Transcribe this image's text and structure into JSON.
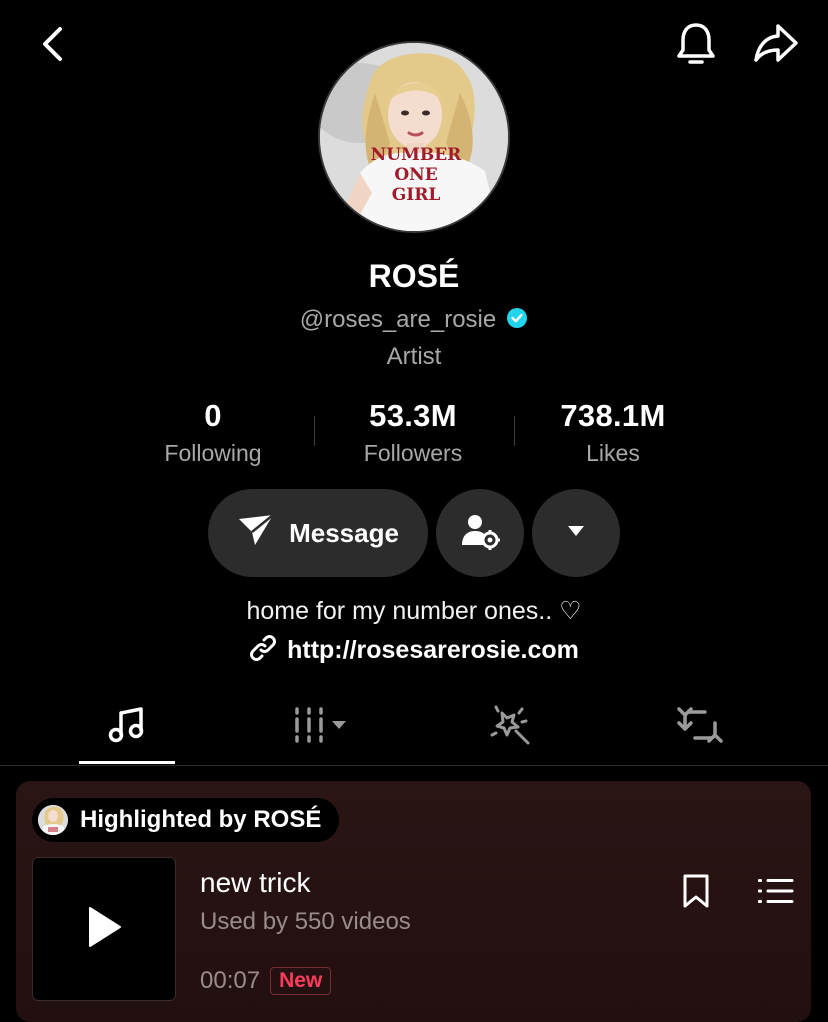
{
  "profile": {
    "name": "ROSÉ",
    "handle": "@roses_are_rosie",
    "category": "Artist",
    "shirt_text": [
      "NUMBER",
      "ONE",
      "GIRL"
    ]
  },
  "stats": [
    {
      "value": "0",
      "label": "Following"
    },
    {
      "value": "53.3M",
      "label": "Followers"
    },
    {
      "value": "738.1M",
      "label": "Likes"
    }
  ],
  "actions": {
    "message_label": "Message"
  },
  "bio": {
    "text": "home for my number ones.. ♡",
    "link": "http://rosesarerosie.com"
  },
  "tabs": [
    {
      "icon": "music-note-icon",
      "active": true
    },
    {
      "icon": "grid-dropdown-icon",
      "active": false
    },
    {
      "icon": "effects-icon",
      "active": false
    },
    {
      "icon": "repost-icon",
      "active": false
    }
  ],
  "highlight": {
    "label": "Highlighted by ROSÉ",
    "track": {
      "title": "new trick",
      "used_by": "Used by 550 videos",
      "duration": "00:07",
      "badge": "New"
    }
  },
  "colors": {
    "background": "#000000",
    "secondary_text": "#a8a8a8",
    "pill": "#2c2c2c",
    "verified": "#20d5ec",
    "new_badge": "#ff3b5c",
    "card": "#2a1515"
  }
}
